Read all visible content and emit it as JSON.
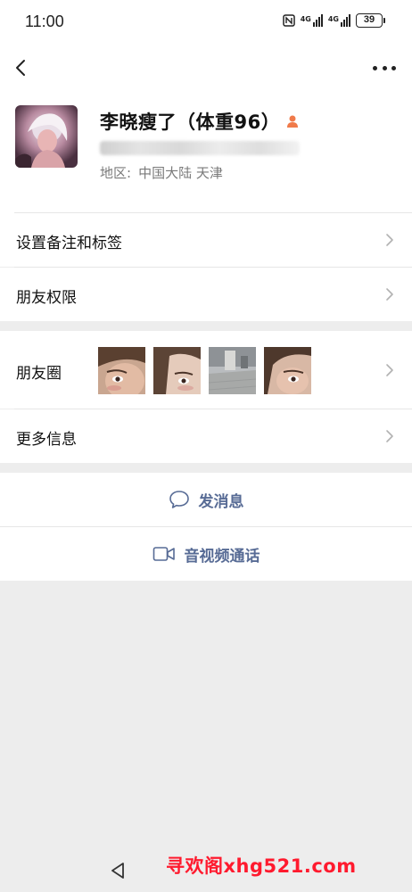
{
  "status_bar": {
    "time": "11:00",
    "network_1": "4G",
    "network_2": "4G",
    "battery": "39",
    "nfc_icon": "nfc-icon"
  },
  "header": {
    "back_icon": "chevron-left-icon",
    "more_icon": "more-dots-icon"
  },
  "profile": {
    "name": "李晓瘦了（体重96）",
    "gender_icon": "female-person-icon",
    "region_label": "地区:",
    "region_value": "中国大陆  天津"
  },
  "menu": {
    "remark_tags": "设置备注和标签",
    "friend_permissions": "朋友权限",
    "moments": "朋友圈",
    "more_info": "更多信息"
  },
  "actions": {
    "send_message": "发消息",
    "video_call": "音视频通话"
  },
  "watermark": "寻欢阁xhg521.com",
  "colors": {
    "link_blue": "#576b95",
    "gender_orange": "#f07a4a",
    "watermark_red": "#ff1a2e",
    "page_bg": "#ededed"
  }
}
